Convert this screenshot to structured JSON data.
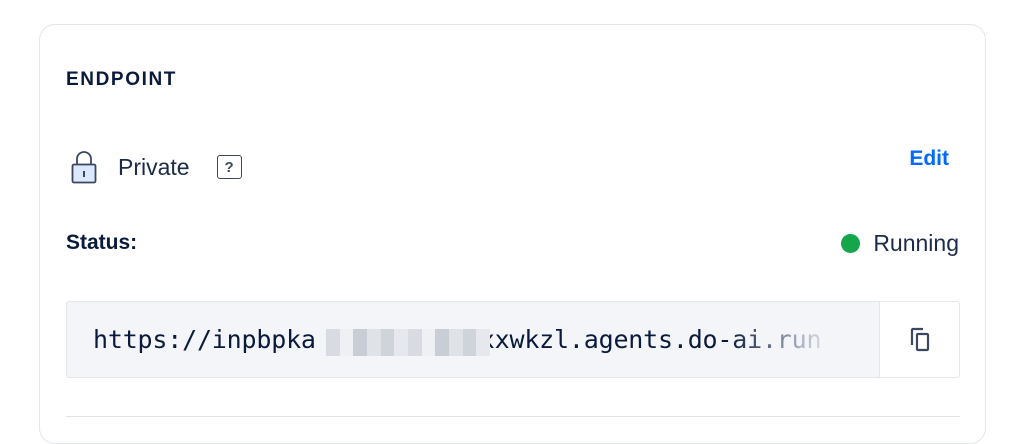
{
  "endpoint": {
    "section_title": "ENDPOINT",
    "access": {
      "label": "Private",
      "icon": "lock-icon",
      "help_icon_label": "?",
      "edit_label": "Edit"
    },
    "status": {
      "label": "Status:",
      "value": "Running",
      "color": "#15a64c"
    },
    "url": {
      "value": "https://inpbpka███████████xxwkzl.agents.do-ai.run",
      "visible_start": "https://inpbpka",
      "visible_end": "xxwkzl.agents.do-ai.run",
      "redacted": true
    },
    "copy": {
      "icon": "copy-icon"
    }
  },
  "colors": {
    "accent": "#0069ff",
    "text": "#1b2a4a",
    "panel_bg": "#f3f5f9",
    "border": "#e3e6ec"
  }
}
